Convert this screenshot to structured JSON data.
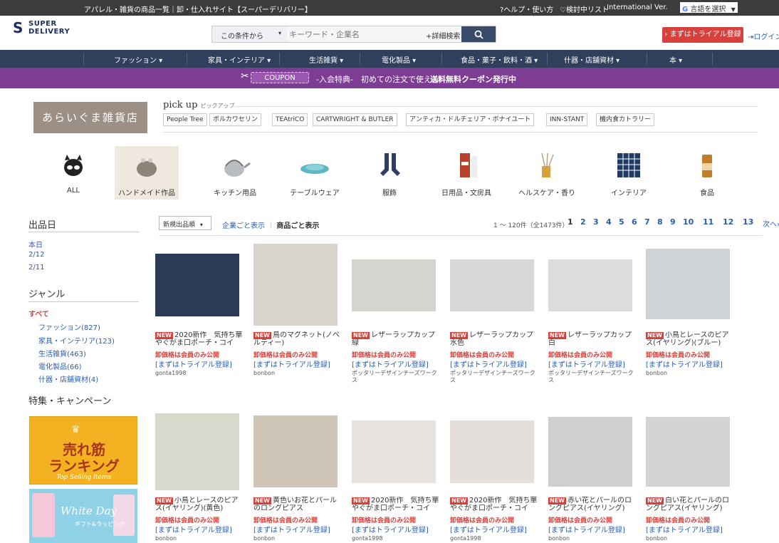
{
  "topbar": {
    "title": "アパレル・雑貨の商品一覧｜卸・仕入れサイト【スーパーデリバリー】",
    "help": "?ヘルプ・使い方",
    "watch": "♡検討中リスト",
    "intl": "International Ver.",
    "lang": "言語を選択",
    "lang_arrow": "▼"
  },
  "logo": {
    "line1": "SUPER",
    "line2": "DELIVERY"
  },
  "search": {
    "condition": "この条件から",
    "arrow": "▾",
    "placeholder": "キーワード・企業名",
    "advanced": "+詳細検索",
    "button_icon": "search-icon"
  },
  "trial_button": "› まずはトライアル登録",
  "login": "ログイン",
  "nav": [
    "ファッション ▾",
    "家具・インテリア ▾",
    "生活雑貨 ▾",
    "電化製品 ▾",
    "食品・菓子・飲料・酒 ▾",
    "什器・店舗資材 ▾",
    "本 ▾"
  ],
  "coupon": {
    "tag": "COUPON",
    "text1": "-入会特典-　初めての注文で使える！",
    "text2": "送料無料クーポン発行中"
  },
  "shop_name": "あらいぐま雑貨店",
  "pickup": {
    "title": "pick up",
    "sub": "ピックアップ",
    "brands": [
      "People Tree",
      "ポルカワセリン",
      "TEAtriCO",
      "CARTWRIGHT & BUTLER",
      "アンティカ・ドルチェリア・ボナイユート",
      "INN-STANT",
      "機内食カトラリー"
    ]
  },
  "categories": [
    "ALL",
    "ハンドメイド作品",
    "キッチン用品",
    "テーブルウェア",
    "服飾",
    "日用品・文房具",
    "ヘルスケア・香り",
    "インテリア",
    "食品"
  ],
  "sidebar": {
    "date_heading": "出品日",
    "dates": [
      "本日",
      "2/12",
      "2/11"
    ],
    "genre_heading": "ジャンル",
    "genre_all": "すべて",
    "genres": [
      "ファッション(827)",
      "家具・インテリア(123)",
      "生活雑貨(463)",
      "電化製品(66)",
      "什器・店舗資材(4)"
    ],
    "feature_heading": "特集・キャンペーン",
    "banner1": {
      "line1": "売れ筋",
      "line2": "ランキング",
      "line3": "Top Selling Items"
    },
    "banner2": {
      "line1": "White Day",
      "line2": "ギフト&ラッピング"
    }
  },
  "toolbar": {
    "sort": "新規出品順",
    "sort_arrow": "▾",
    "view_company": "企業ごと表示",
    "sep": "｜",
    "view_product": "商品ごと表示",
    "count": "1 ～ 120件（全1473件）",
    "pages": [
      "1",
      "2",
      "3",
      "4",
      "5",
      "6",
      "7",
      "8",
      "9",
      "10",
      "11",
      "12",
      "13",
      "次へ›"
    ]
  },
  "products": [
    {
      "new": "NEW",
      "name": "2020新作　気持ち華やぐがま口ポーチ・コイ",
      "price": "卸価格は会員のみ公開",
      "trial": "[まずはトライアル登録]",
      "shop": "gonta1998"
    },
    {
      "new": "NEW",
      "name": "鳥のマグネット(ノベルティー)",
      "price": "卸価格は会員のみ公開",
      "trial": "[まずはトライアル登録]",
      "shop": "bonbon"
    },
    {
      "new": "NEW",
      "name": "レザーラップカップ　緑",
      "price": "卸価格は会員のみ公開",
      "trial": "[まずはトライアル登録]",
      "shop": "ポッタリーデザインチーズワークス"
    },
    {
      "new": "NEW",
      "name": "レザーラップカップ　水色",
      "price": "卸価格は会員のみ公開",
      "trial": "[まずはトライアル登録]",
      "shop": "ポッタリーデザインチーズワークス"
    },
    {
      "new": "NEW",
      "name": "レザーラップカップ　白",
      "price": "卸価格は会員のみ公開",
      "trial": "[まずはトライアル登録]",
      "shop": "ポッタリーデザインチーズワークス"
    },
    {
      "new": "NEW",
      "name": "小鳥とレースのピアス(イヤリング)(ブルー)",
      "price": "卸価格は会員のみ公開",
      "trial": "[まずはトライアル登録]",
      "shop": "bonbon"
    },
    {
      "new": "NEW",
      "name": "小鳥とレースのピアス(イヤリング)(黄色)",
      "price": "卸価格は会員のみ公開",
      "trial": "[まずはトライアル登録]",
      "shop": "bonbon"
    },
    {
      "new": "NEW",
      "name": "黄色いお花とパールのロングピアス",
      "price": "卸価格は会員のみ公開",
      "trial": "[まずはトライアル登録]",
      "shop": "bonbon"
    },
    {
      "new": "NEW",
      "name": "2020新作　気持ち華やぐがま口ポーチ・コイ",
      "price": "卸価格は会員のみ公開",
      "trial": "[まずはトライアル登録]",
      "shop": "gonta1998"
    },
    {
      "new": "NEW",
      "name": "2020新作　気持ち華やぐがま口ポーチ・コイ",
      "price": "卸価格は会員のみ公開",
      "trial": "[まずはトライアル登録]",
      "shop": "gonta1998"
    },
    {
      "new": "NEW",
      "name": "赤い花とパールのロングピアス(イヤリング)",
      "price": "卸価格は会員のみ公開",
      "trial": "[まずはトライアル登録]",
      "shop": "bonbon"
    },
    {
      "new": "NEW",
      "name": "白い花とパールのロングピアス(イヤリング)",
      "price": "卸価格は会員のみ公開",
      "trial": "[まずはトライアル登録]",
      "shop": "bonbon"
    }
  ],
  "colors": {
    "nav": "#2f3f5c",
    "coupon": "#7c3d93",
    "accent_red": "#d8403c",
    "link": "#2a5db0"
  }
}
